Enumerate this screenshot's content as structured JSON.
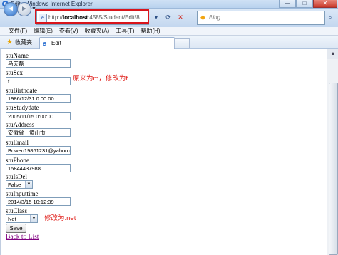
{
  "window": {
    "title": "Edit - Windows Internet Explorer",
    "minimize": "—",
    "maximize": "□",
    "close": "✕"
  },
  "address": {
    "url_prefix": "http://",
    "url_host": "localhost",
    "url_path": ":4585/Student/Edit/8"
  },
  "search": {
    "placeholder": "Bing"
  },
  "menu": [
    "文件(F)",
    "编辑(E)",
    "查看(V)",
    "收藏夹(A)",
    "工具(T)",
    "帮助(H)"
  ],
  "favorites": {
    "label": "收藏夹",
    "tab_label": "Edit"
  },
  "form": {
    "fields": [
      {
        "label": "stuName",
        "value": "马天磊"
      },
      {
        "label": "stuSex",
        "value": "f"
      },
      {
        "label": "stuBirthdate",
        "value": "1986/12/31 0:00:00"
      },
      {
        "label": "stuStudydate",
        "value": "2005/11/15 0:00:00"
      },
      {
        "label": "stuAddress",
        "value": "安徽省　黄山市"
      },
      {
        "label": "stuEmail",
        "value": "Bowen19861231@yahoo.c"
      },
      {
        "label": "stuPhone",
        "value": "15844437988"
      },
      {
        "label": "stuIsDel",
        "value": "False"
      },
      {
        "label": "stuInputtime",
        "value": "2014/3/15 10:12:39"
      },
      {
        "label": "stuClass",
        "value": "Net"
      }
    ],
    "save_label": "Save",
    "back_link": "Back to List"
  },
  "annotations": {
    "sex_note": "原来为m，修改为f",
    "class_note": "修改为.net"
  },
  "colors": {
    "annotation": "#e0201b",
    "highlight_box": "#d9141b",
    "link_visited": "#800080"
  }
}
